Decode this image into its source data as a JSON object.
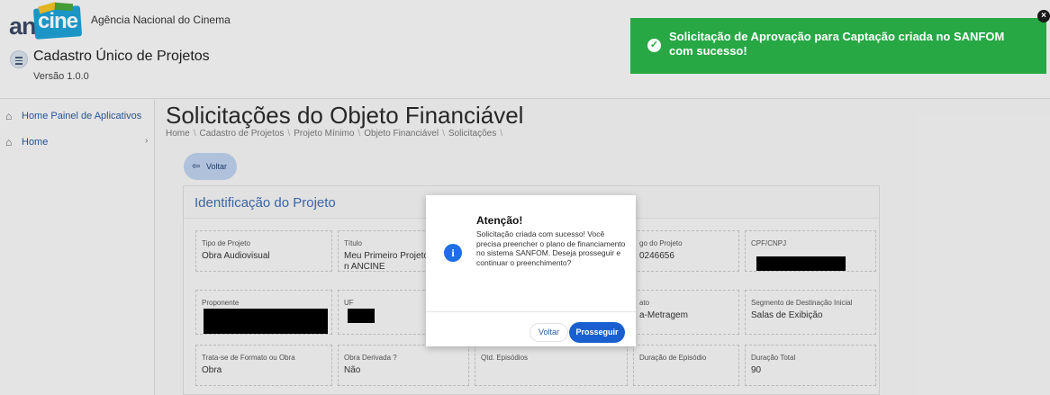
{
  "header": {
    "logo_an": "an",
    "logo_cine": "cine",
    "agency": "Agência Nacional do Cinema",
    "system_name": "Cadastro Único de Projetos",
    "version": "Versão 1.0.0"
  },
  "toast": {
    "message": "Solicitação de Aprovação para Captação criada no SANFOM com sucesso!",
    "close": "×",
    "color": "#27a844"
  },
  "sidebar": {
    "items": [
      {
        "label": "Home Painel de Aplicativos",
        "icon": "home-apps-icon"
      },
      {
        "label": "Home",
        "icon": "home-icon"
      }
    ],
    "chevron": "›"
  },
  "main": {
    "title": "Solicitações do Objeto Financiável",
    "breadcrumb": [
      "Home",
      "Cadastro de Projetos",
      "Projeto Mínimo",
      "Objeto Financiável",
      "Solicitações"
    ],
    "back_label": "Voltar"
  },
  "card": {
    "title": "Identificação do Projeto",
    "fields": [
      {
        "label": "Tipo de Projeto",
        "value": "Obra Audiovisual"
      },
      {
        "label": "Título",
        "value": "Meu Primeiro Projeto n ANCINE"
      },
      {
        "label": "",
        "value": ""
      },
      {
        "label": "go do Projeto",
        "value": "0246656"
      },
      {
        "label": "CPF/CNPJ",
        "value": ""
      },
      {
        "label": "Proponente",
        "value": ""
      },
      {
        "label": "UF",
        "value": ""
      },
      {
        "label": "",
        "value": ""
      },
      {
        "label": "ato",
        "value": "a-Metragem"
      },
      {
        "label": "Segmento de Destinação Inicial",
        "value": "Salas de Exibição"
      },
      {
        "label": "Trata-se de Formato ou Obra",
        "value": "Obra"
      },
      {
        "label": "Obra Derivada ?",
        "value": "Não"
      },
      {
        "label": "Qtd. Episódios",
        "value": ""
      },
      {
        "label": "Duração de Episódio",
        "value": ""
      },
      {
        "label": "Duração Total",
        "value": "90"
      }
    ]
  },
  "modal": {
    "title": "Atenção!",
    "message": "Solicitação criada com sucesso! Você precisa preencher o plano de financiamento no sistema SANFOM. Deseja prosseguir e continuar o preenchimento?",
    "back_label": "Voltar",
    "proceed_label": "Prosseguir",
    "info_icon": "i"
  }
}
